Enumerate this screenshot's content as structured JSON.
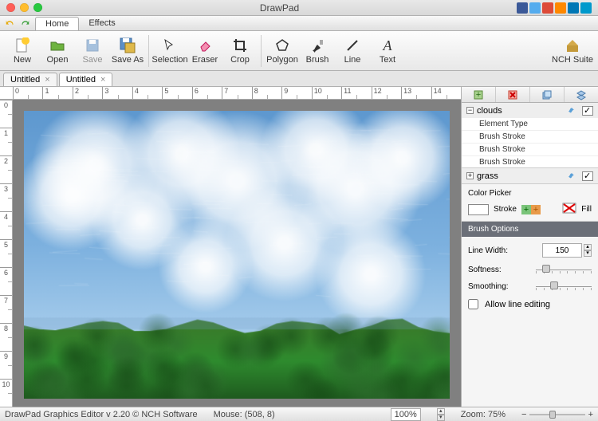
{
  "app": {
    "title": "DrawPad"
  },
  "menu": {
    "items": [
      "Home",
      "Effects"
    ],
    "active": 0
  },
  "toolbar": {
    "new": "New",
    "open": "Open",
    "save": "Save",
    "saveas": "Save As",
    "selection": "Selection",
    "eraser": "Eraser",
    "crop": "Crop",
    "polygon": "Polygon",
    "brush": "Brush",
    "line": "Line",
    "text": "Text",
    "nch": "NCH Suite"
  },
  "tabs": [
    {
      "label": "Untitled"
    },
    {
      "label": "Untitled"
    }
  ],
  "hruler": [
    "0",
    "1",
    "2",
    "3",
    "4",
    "5",
    "6",
    "7",
    "8",
    "9",
    "10",
    "11",
    "12",
    "13",
    "14"
  ],
  "vruler": [
    "0",
    "1",
    "2",
    "3",
    "4",
    "5",
    "6",
    "7",
    "8",
    "9",
    "10"
  ],
  "layers": {
    "groups": [
      {
        "name": "clouds",
        "expanded": true,
        "rows": [
          "Element Type",
          "Brush Stroke",
          "Brush Stroke",
          "Brush Stroke"
        ]
      },
      {
        "name": "grass",
        "expanded": false,
        "rows": []
      }
    ]
  },
  "colorpicker": {
    "title": "Color Picker",
    "stroke": "Stroke",
    "fill": "Fill"
  },
  "brush": {
    "header": "Brush Options",
    "linewidth_label": "Line Width:",
    "linewidth": "150",
    "softness_label": "Softness:",
    "smoothing_label": "Smoothing:",
    "allow_edit": "Allow line editing"
  },
  "status": {
    "app": "DrawPad Graphics Editor v 2.20 © NCH Software",
    "mouse": "Mouse: (508, 8)",
    "pct": "100%",
    "zoom": "Zoom: 75%"
  },
  "social_colors": [
    "#3b5998",
    "#55acee",
    "#dd4b39",
    "#ff8800",
    "#0077b5",
    "#0099cc"
  ]
}
